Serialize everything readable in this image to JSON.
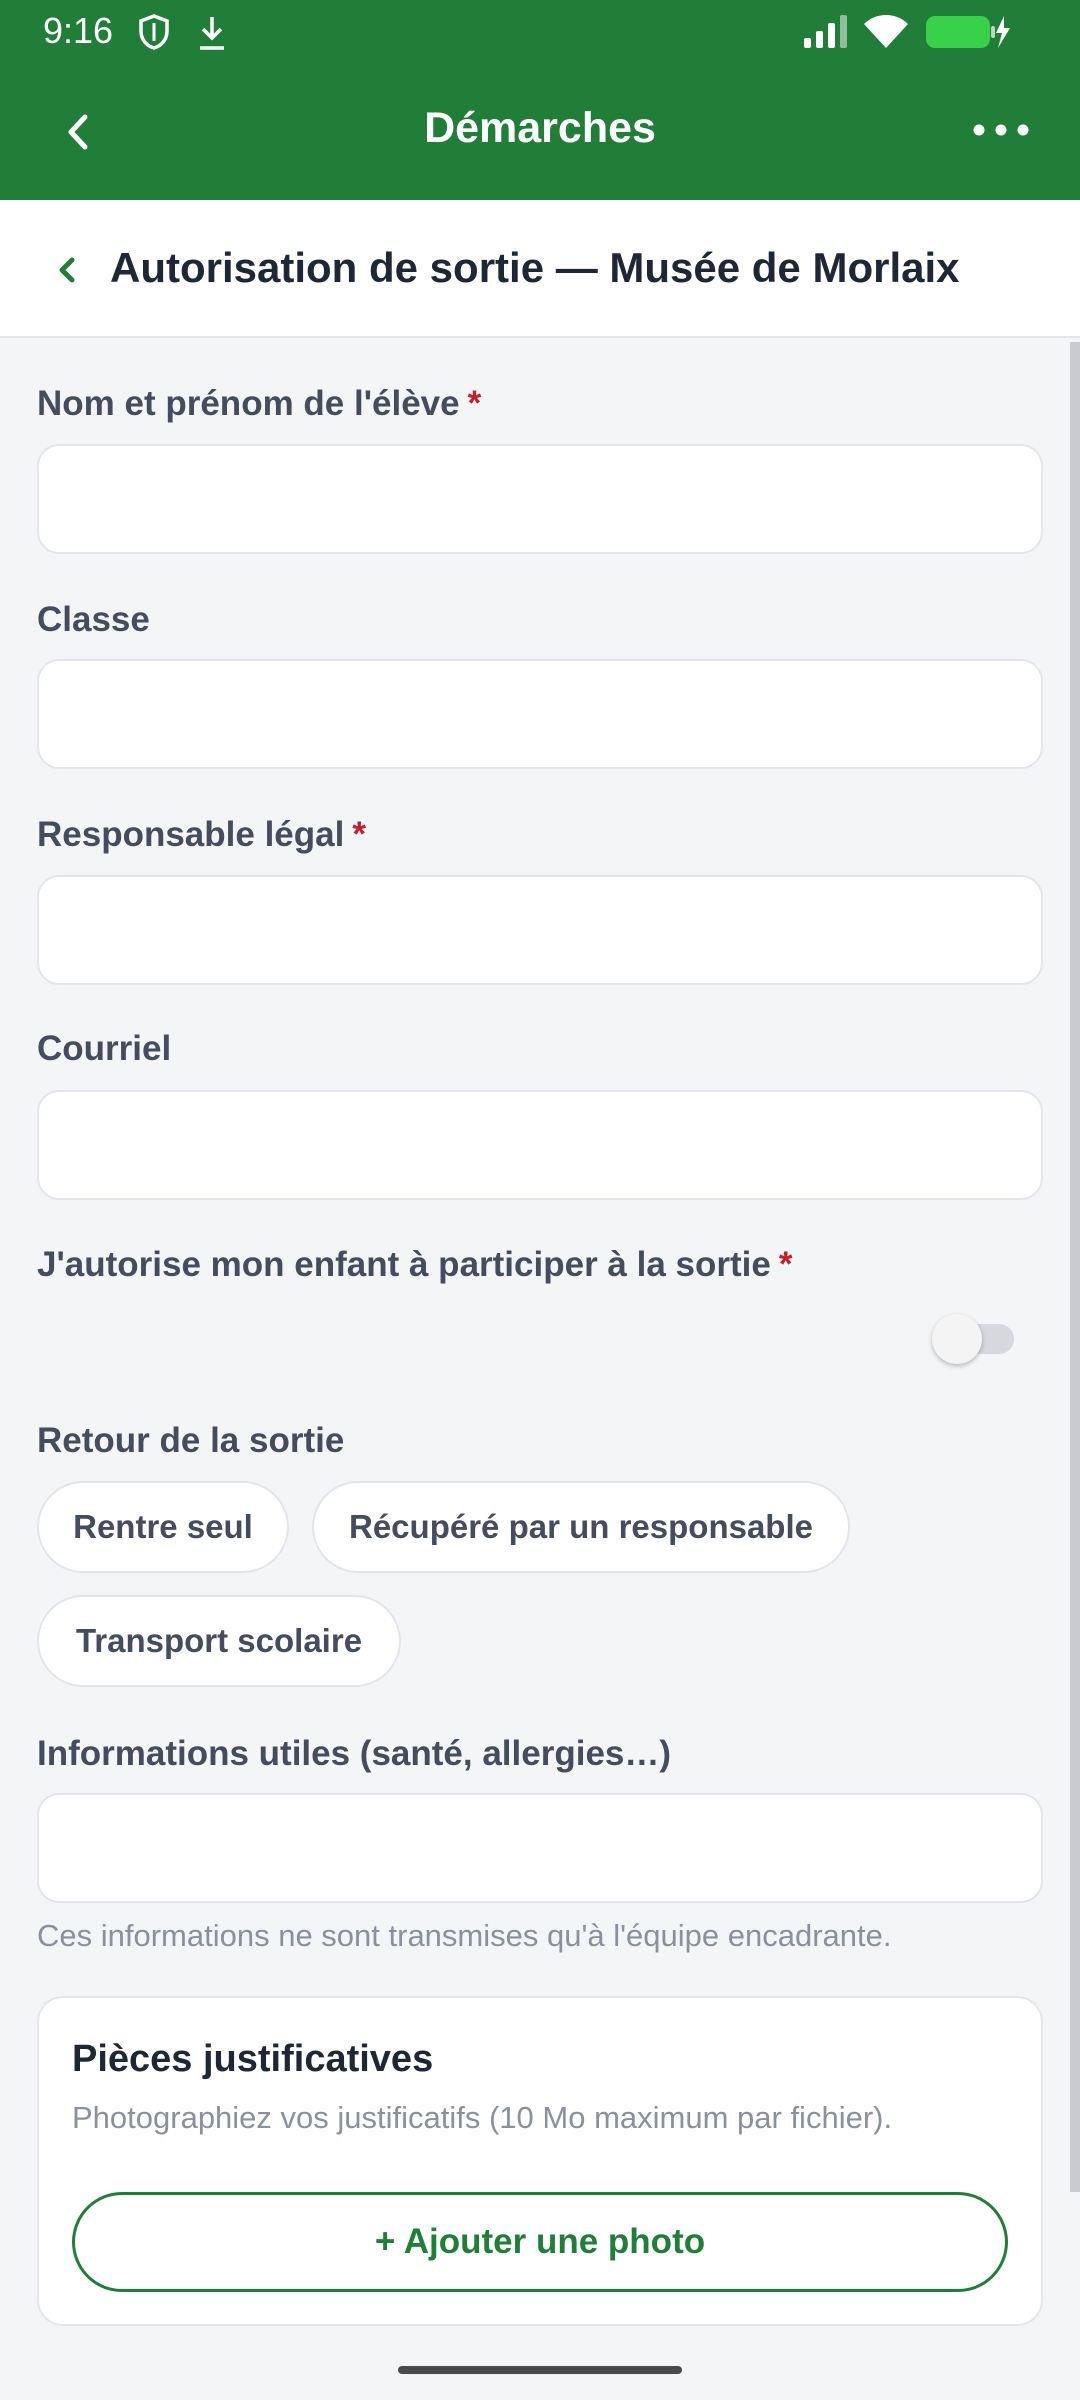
{
  "status_bar": {
    "time": "9:16",
    "icons": [
      "shield-icon",
      "download-icon",
      "signal-icon",
      "wifi-icon",
      "battery-charging-icon"
    ]
  },
  "app_bar": {
    "title": "Démarches",
    "back_icon": "chevron-left-icon",
    "menu_icon": "more-horizontal-icon"
  },
  "subheader": {
    "title": "Autorisation de sortie — Musée de Morlaix"
  },
  "form": {
    "required_marker": "*",
    "fields": [
      {
        "label": "Nom et prénom de l'élève",
        "required": true,
        "value": ""
      },
      {
        "label": "Classe",
        "required": false,
        "value": ""
      },
      {
        "label": "Responsable légal",
        "required": true,
        "value": ""
      },
      {
        "label": "Courriel",
        "required": false,
        "value": ""
      }
    ],
    "consent": {
      "label": "J'autorise mon enfant à participer à la sortie",
      "required": true,
      "toggled": false
    },
    "return": {
      "label": "Retour de la sortie",
      "options": [
        "Rentre seul",
        "Récupéré par un responsable",
        "Transport scolaire"
      ]
    },
    "info": {
      "label": "Informations utiles (santé, allergies…)",
      "value": "",
      "hint": "Ces informations ne sont transmises qu'à l'équipe encadrante."
    }
  },
  "attachments": {
    "title": "Pièces justificatives",
    "description": "Photographiez vos justificatifs (10 Mo maximum par fichier).",
    "add_button": "+ Ajouter une photo"
  },
  "colors": {
    "brand_green": "#217e38",
    "required_red": "#c51f2b",
    "background": "#f4f5f7"
  }
}
